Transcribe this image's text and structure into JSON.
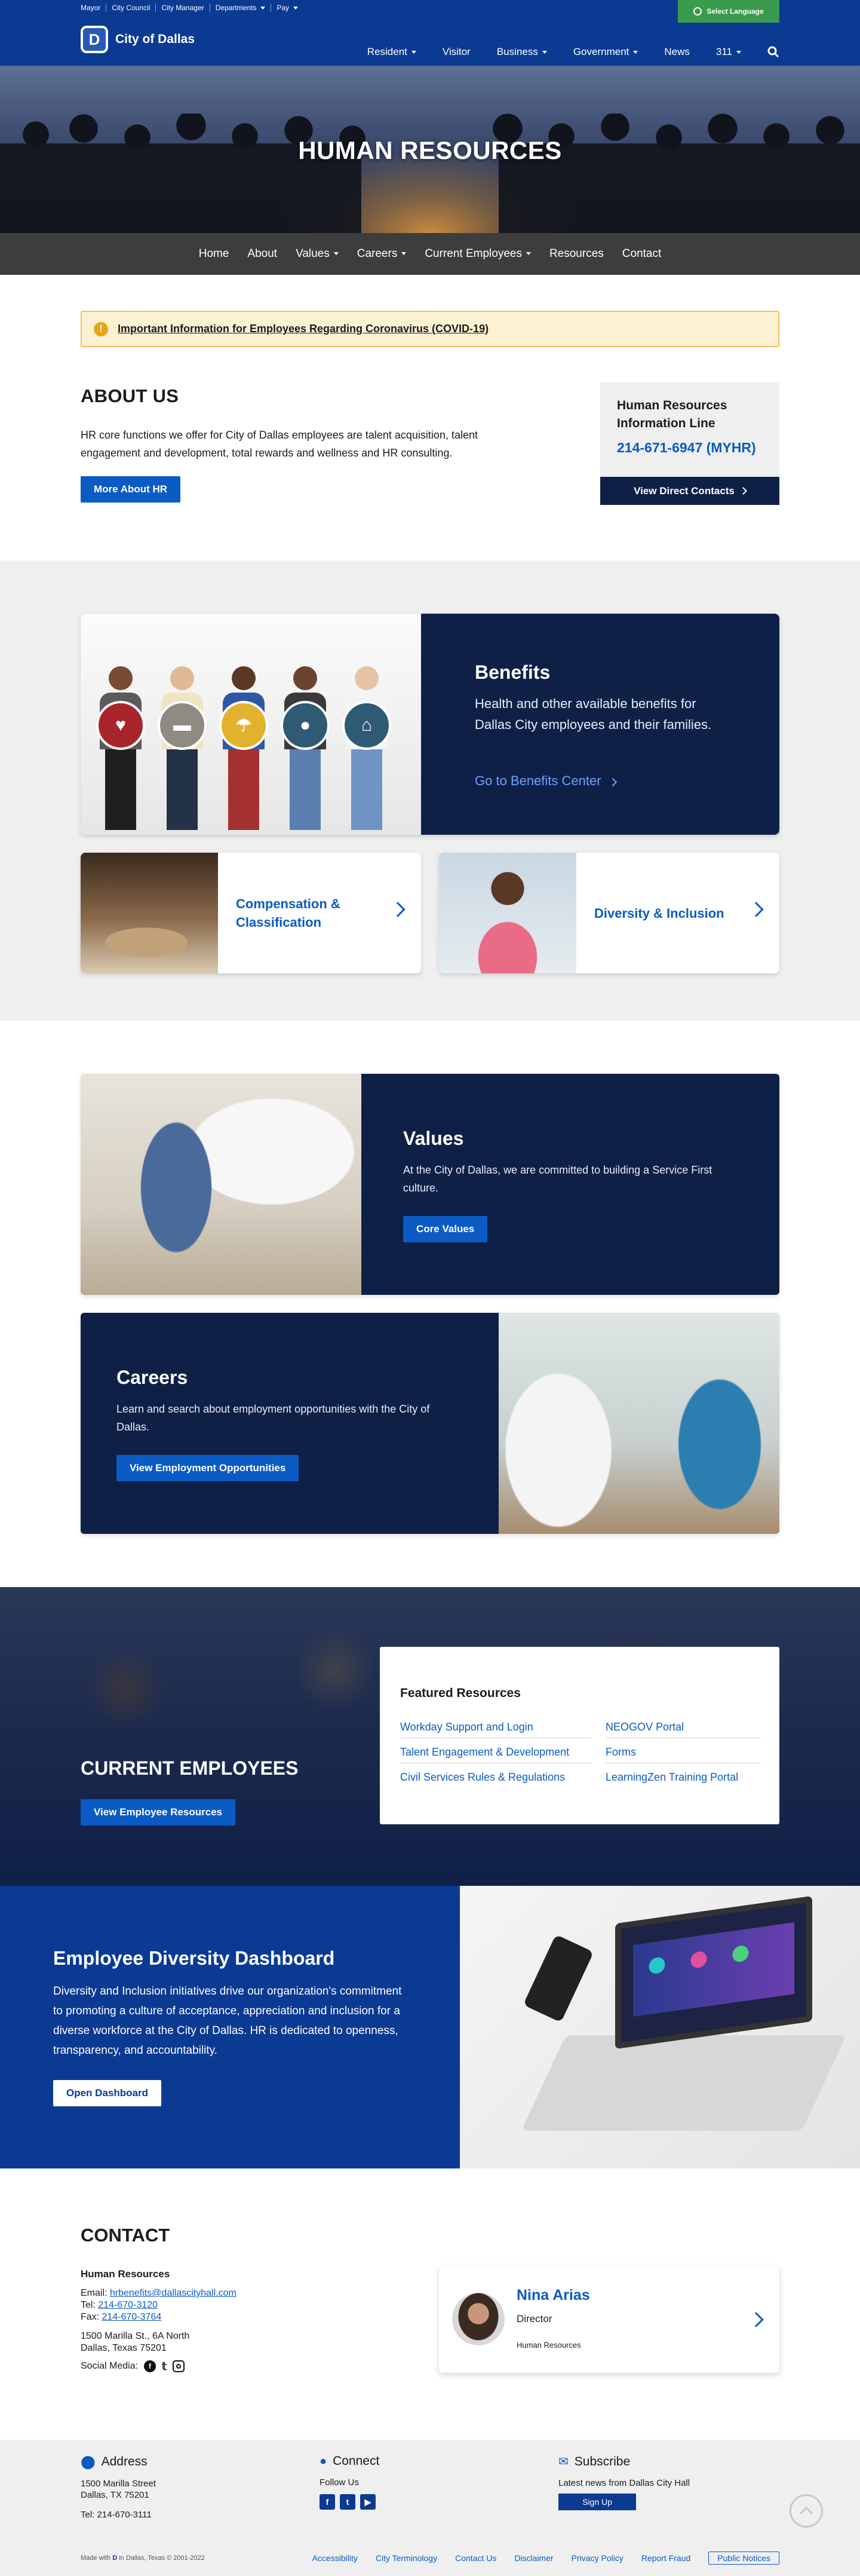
{
  "utility": {
    "links": [
      "Mayor",
      "City Council",
      "City Manager",
      "Departments",
      "Pay"
    ],
    "language_button": "Select Language"
  },
  "header": {
    "logo_mark": "D",
    "logo_text": "City of Dallas",
    "nav": [
      "Resident",
      "Visitor",
      "Business",
      "Government",
      "News",
      "311"
    ]
  },
  "hero": {
    "title": "HUMAN RESOURCES"
  },
  "section_nav": [
    "Home",
    "About",
    "Values",
    "Careers",
    "Current Employees",
    "Resources",
    "Contact"
  ],
  "alert": {
    "icon": "!",
    "text": "Important Information for Employees Regarding Coronavirus (COVID-19)"
  },
  "about": {
    "title": "ABOUT US",
    "body": "HR core functions we offer for City of Dallas employees are talent acquisition, talent engagement and development, total rewards and wellness and HR consulting.",
    "button": "More About HR"
  },
  "info_line": {
    "title": "Human Resources Information Line",
    "phone": "214-671-6947 (MYHR)",
    "button": "View Direct Contacts"
  },
  "benefits": {
    "title": "Benefits",
    "body": "Health and other available benefits for Dallas City employees and their families.",
    "link": "Go to Benefits Center"
  },
  "cards": {
    "compensation": "Compensation & Classification",
    "diversity": "Diversity & Inclusion"
  },
  "values": {
    "title": "Values",
    "body": "At the City of Dallas, we are committed to building a Service First culture.",
    "button": "Core Values"
  },
  "careers": {
    "title": "Careers",
    "body": "Learn and search about employment opportunities with the City of Dallas.",
    "button": "View Employment Opportunities"
  },
  "current_employees": {
    "title": "CURRENT EMPLOYEES",
    "button": "View Employee Resources",
    "featured_title": "Featured Resources",
    "featured_left": [
      "Workday Support and Login",
      "Talent Engagement & Development",
      "Civil Services Rules & Regulations"
    ],
    "featured_right": [
      "NEOGOV Portal",
      "Forms",
      "LearningZen Training Portal"
    ]
  },
  "dashboard": {
    "title": "Employee Diversity Dashboard",
    "body": "Diversity and Inclusion initiatives drive our organization's commitment to promoting a culture of acceptance, appreciation and inclusion for a diverse workforce at the City of Dallas. HR is dedicated to openness, transparency, and accountability.",
    "button": "Open Dashboard"
  },
  "contact": {
    "title": "CONTACT",
    "org": "Human Resources",
    "email_label": "Email:",
    "email": "hrbenefits@dallascityhall.com",
    "tel_label": "Tel:",
    "tel": "214-670-3120",
    "fax_label": "Fax:",
    "fax": "214-670-3764",
    "address1": "1500 Marilla St., 6A North",
    "address2": "Dallas, Texas 75201",
    "social_label": "Social Media:",
    "person_name": "Nina Arias",
    "person_title": "Director",
    "person_dept": "Human Resources"
  },
  "footer": {
    "address_h": "Address",
    "address1": "1500 Marilla Street",
    "address2": "Dallas, TX 75201",
    "address_tel": "Tel: 214-670-3111",
    "connect_h": "Connect",
    "follow": "Follow Us",
    "subscribe_h": "Subscribe",
    "subscribe_text": "Latest news from Dallas City Hall",
    "signup": "Sign Up",
    "made_with": "Made with",
    "made_rest": "in Dallas, Texas © 2001-2022",
    "links": [
      "Accessibility",
      "City Terminology",
      "Contact Us",
      "Disclaimer",
      "Privacy Policy",
      "Report Fraud"
    ],
    "public_notices": "Public Notices"
  },
  "colors": {
    "brand_blue": "#0b3a93",
    "navy": "#0f2047",
    "link_blue": "#0b5bc4",
    "language_green": "#3a9b4e",
    "alert_bg": "#fdf1d4"
  }
}
